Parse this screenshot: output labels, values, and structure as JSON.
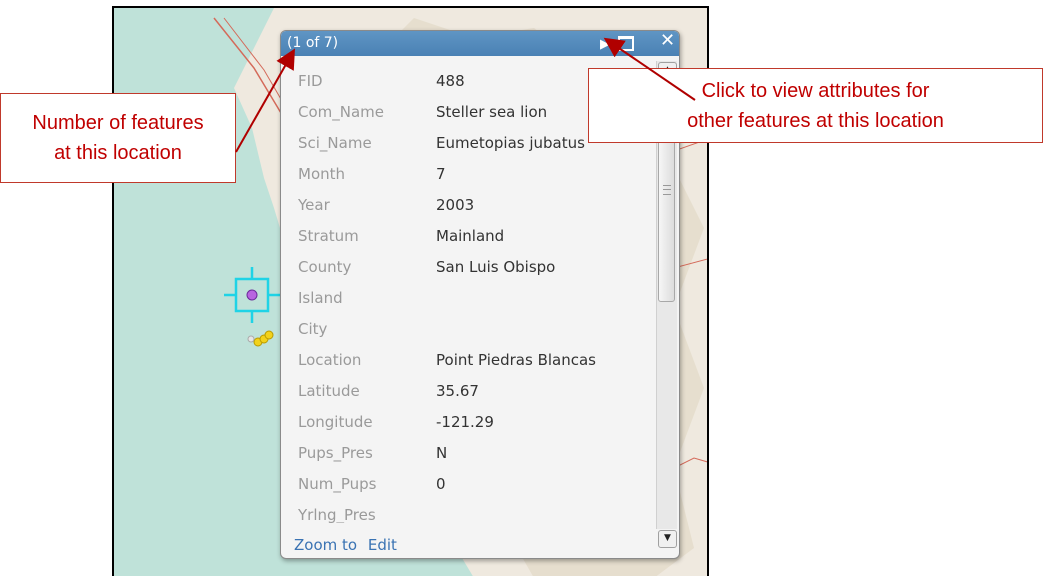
{
  "popup": {
    "count_label": "(1 of 7)",
    "next_icon": "play-arrow-icon",
    "maximize_icon": "maximize-icon",
    "close_glyph": "✕",
    "attributes": [
      {
        "key": "FID",
        "value": "488"
      },
      {
        "key": "Com_Name",
        "value": "Steller sea lion"
      },
      {
        "key": "Sci_Name",
        "value": "Eumetopias jubatus"
      },
      {
        "key": "Month",
        "value": "7"
      },
      {
        "key": "Year",
        "value": "2003"
      },
      {
        "key": "Stratum",
        "value": "Mainland"
      },
      {
        "key": "County",
        "value": "San Luis Obispo"
      },
      {
        "key": "Island",
        "value": ""
      },
      {
        "key": "City",
        "value": ""
      },
      {
        "key": "Location",
        "value": "Point Piedras Blancas"
      },
      {
        "key": "Latitude",
        "value": "35.67"
      },
      {
        "key": "Longitude",
        "value": "-121.29"
      },
      {
        "key": "Pups_Pres",
        "value": "N"
      },
      {
        "key": "Num_Pups",
        "value": "0"
      },
      {
        "key": "Yrlng_Pres",
        "value": ""
      }
    ],
    "footer": {
      "zoom_label": "Zoom to",
      "edit_label": "Edit"
    }
  },
  "callouts": {
    "left_line1": "Number of features",
    "left_line2": "at this location",
    "right_line1": "Click to view attributes for",
    "right_line2": "other features at this location"
  },
  "colors": {
    "header": "#4a81b4",
    "callout_text": "#c00000",
    "water": "#bfe2d9",
    "land": "#efe9df"
  }
}
